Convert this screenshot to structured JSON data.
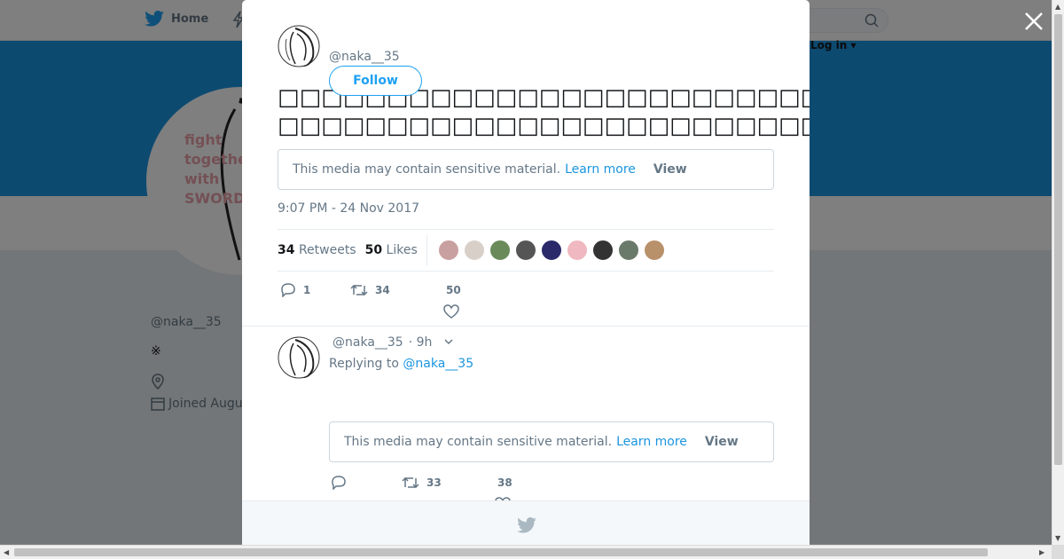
{
  "nav": {
    "home_label": "Home",
    "login_label": "Log in ▾"
  },
  "profile": {
    "handle": "@naka__35",
    "bio": "※",
    "joined": "Joined Augu"
  },
  "avatar_text": [
    "fight",
    "together",
    "with",
    "SWORD"
  ],
  "tweet": {
    "handle": "@naka__35",
    "follow_label": "Follow",
    "text_line1": "□□□□□□□□□□□□□□□□□□□□□□□□□□□□□□□□□□□□□□□□□□",
    "text_line2": "□□□□□□□□□□□□□□□□□□□□□□□□□□□□□□□□□□□□□□□□Lady Ga",
    "sensitive_text": "This media may contain sensitive material.",
    "learn_more": "Learn more",
    "view_label": "View",
    "timestamp": "9:07 PM - 24 Nov 2017",
    "retweets_count": "34",
    "retweets_label": "Retweets",
    "likes_count": "50",
    "likes_label": "Likes",
    "likers_colors": [
      "#c9a0a0",
      "#d8d0c8",
      "#6a8a5a",
      "#555555",
      "#2a2a6a",
      "#f0b8c0",
      "#333333",
      "#6a7a6a",
      "#b8906a"
    ],
    "reply_count": "1",
    "retweet_action_count": "34",
    "like_action_count": "50"
  },
  "reply": {
    "handle": "@naka__35",
    "time": "· 9h",
    "replying_to_label": "Replying to",
    "replying_to_handle": "@naka__35",
    "sensitive_text": "This media may contain sensitive material.",
    "learn_more": "Learn more",
    "view_label": "View",
    "retweet_count": "33",
    "like_count": "38"
  },
  "colors": {
    "brand": "#1da1f2",
    "banner": "#1b95e0",
    "muted": "#657786"
  }
}
